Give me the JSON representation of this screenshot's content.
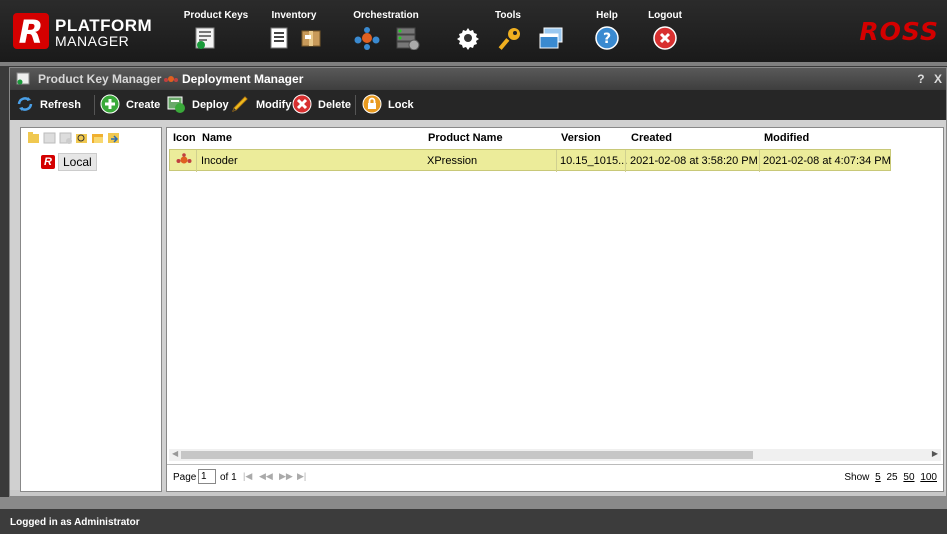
{
  "app": {
    "logo_line1": "PLATFORM",
    "logo_line2": "MANAGER",
    "logo_letter": "R",
    "brand": "ROSS",
    "brand_color": "#d40000"
  },
  "menu": {
    "product_keys": "Product Keys",
    "inventory": "Inventory",
    "orchestration": "Orchestration",
    "tools": "Tools",
    "help": "Help",
    "logout": "Logout"
  },
  "window": {
    "tab_inactive": "Product Key Manager",
    "tab_active": "Deployment Manager",
    "help_btn": "?",
    "close_btn": "X"
  },
  "toolbar": {
    "refresh": "Refresh",
    "create": "Create",
    "deploy": "Deploy",
    "modify": "Modify",
    "delete": "Delete",
    "lock": "Lock"
  },
  "tree": {
    "root_label": "Local",
    "root_icon_letter": "R"
  },
  "grid": {
    "columns": [
      "Icon",
      "Name",
      "Product Name",
      "Version",
      "Created",
      "Modified"
    ],
    "rows": [
      {
        "name": "Incoder",
        "product_name": "XPression",
        "version": "10.15_1015...",
        "created": "2021-02-08 at 3:58:20 PM",
        "modified": "2021-02-08 at 4:07:34 PM"
      }
    ],
    "row_highlight_color": "#ecec9a"
  },
  "pager": {
    "page_label": "Page",
    "page_value": "1",
    "of_label": "of 1",
    "show_label": "Show",
    "sizes": [
      "5",
      "25",
      "50",
      "100"
    ]
  },
  "status": {
    "text": "Logged in as Administrator"
  }
}
